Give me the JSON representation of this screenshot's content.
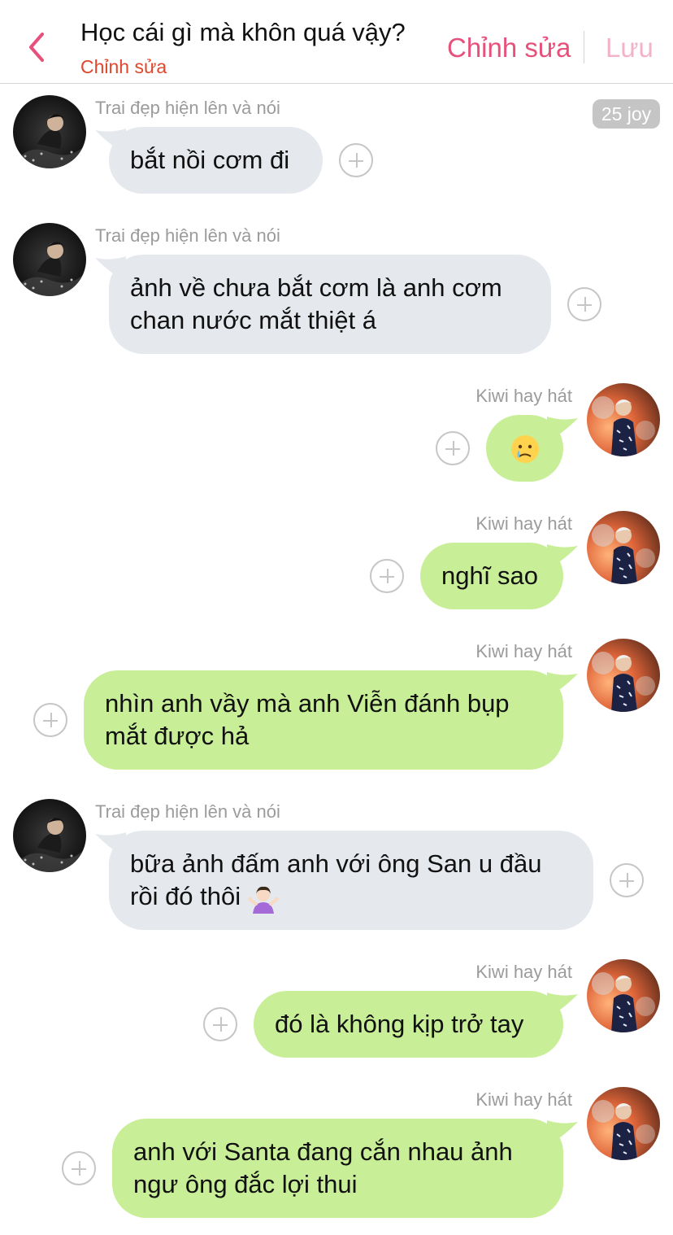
{
  "header": {
    "title": "Học cái gì mà khôn quá vậy?",
    "subtitle": "Chỉnh sửa",
    "edit_label": "Chỉnh sửa",
    "save_label": "Lưu"
  },
  "points_badge": "25 joy",
  "messages": [
    {
      "sender": "Trai đẹp hiện lên và nói",
      "side": "in",
      "lines": [
        "bắt nồi cơm đi"
      ]
    },
    {
      "sender": "Trai đẹp hiện lên và nói",
      "side": "in",
      "lines": [
        "ảnh về chưa bắt cơm là anh cơm",
        "chan nước mắt thiệt á"
      ]
    },
    {
      "sender": "Kiwi hay hát",
      "side": "out",
      "emoji": "sad-tear-emoji"
    },
    {
      "sender": "Kiwi hay hát",
      "side": "out",
      "lines": [
        "nghĩ sao"
      ]
    },
    {
      "sender": "Kiwi hay hát",
      "side": "out",
      "lines": [
        "nhìn anh vầy mà anh Viễn đánh bụp",
        "mắt được hả"
      ]
    },
    {
      "sender": "Trai đẹp hiện lên và nói",
      "side": "in",
      "lines": [
        "bữa ảnh đấm anh với ông San u đầu",
        "rồi đó thôi"
      ],
      "trailing_emoji": "shrugging-woman-emoji"
    },
    {
      "sender": "Kiwi hay hát",
      "side": "out",
      "lines": [
        "đó là không kịp trở tay"
      ]
    },
    {
      "sender": "Kiwi hay hát",
      "side": "out",
      "lines": [
        "anh với Santa đang cắn nhau ảnh",
        "ngư ông đắc lợi thui"
      ]
    }
  ],
  "colors": {
    "accent_pink": "#e8507c",
    "subtitle_red": "#e0462b",
    "incoming_bubble": "#e5e8ed",
    "outgoing_bubble": "#c8ef97"
  }
}
